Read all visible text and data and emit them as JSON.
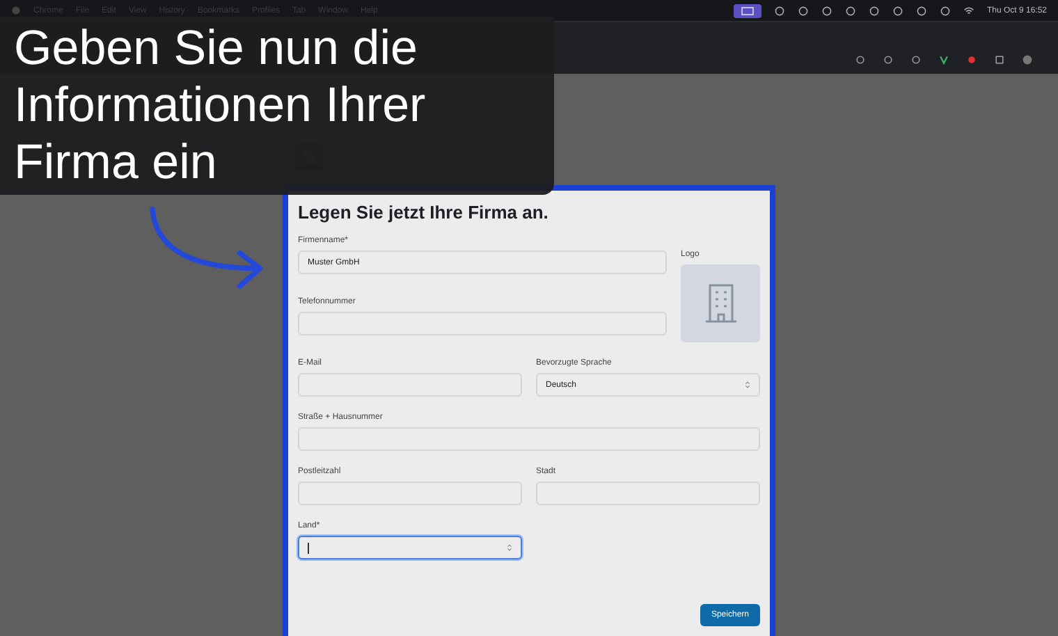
{
  "menu_bar": {
    "items": [
      "Chrome",
      "File",
      "Edit",
      "View",
      "History",
      "Bookmarks",
      "Profiles",
      "Tab",
      "Window",
      "Help"
    ],
    "clock": "Thu Oct 9  16:52"
  },
  "caption": "Geben Sie nun die Informationen Ihrer Firma ein",
  "form": {
    "title": "Legen Sie jetzt Ihre Firma an.",
    "top_fields": [
      {
        "kind": "text",
        "label": "Firmenname*",
        "value": "Muster GmbH",
        "focused": false
      },
      {
        "kind": "text",
        "label": "Telefonnummer",
        "focused": false
      }
    ],
    "logo": {
      "label": "Logo"
    },
    "rows": [
      [
        {
          "kind": "text",
          "label": "E-Mail",
          "focused": false
        },
        {
          "kind": "select",
          "label": "Bevorzugte Sprache",
          "value": "Deutsch",
          "focused": false
        }
      ],
      [
        {
          "kind": "text",
          "label": "Straße + Hausnummer",
          "focused": false
        }
      ],
      [
        {
          "kind": "text",
          "label": "Postleitzahl",
          "focused": false
        },
        {
          "kind": "text",
          "label": "Stadt",
          "focused": false
        }
      ],
      [
        {
          "kind": "select",
          "label": "Land*",
          "focused": true
        },
        {
          "kind": "empty"
        }
      ]
    ],
    "save_button": "Speichern"
  }
}
